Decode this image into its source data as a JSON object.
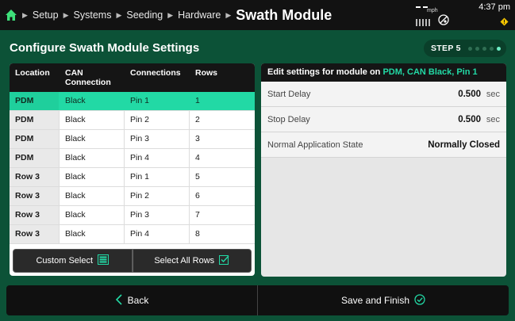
{
  "topbar": {
    "crumbs": [
      "Setup",
      "Systems",
      "Seeding",
      "Hardware"
    ],
    "title": "Swath Module",
    "speed_unit": "mph",
    "time": "4:37 pm"
  },
  "page": {
    "title": "Configure Swath Module Settings",
    "step_label": "STEP 5",
    "step_total": 5,
    "step_current": 5
  },
  "table": {
    "headers": [
      "Location",
      "CAN\nConnection",
      "Connections",
      "Rows"
    ],
    "rows": [
      {
        "location": "PDM",
        "can": "Black",
        "connection": "Pin 1",
        "rows": "1"
      },
      {
        "location": "PDM",
        "can": "Black",
        "connection": "Pin 2",
        "rows": "2"
      },
      {
        "location": "PDM",
        "can": "Black",
        "connection": "Pin 3",
        "rows": "3"
      },
      {
        "location": "PDM",
        "can": "Black",
        "connection": "Pin 4",
        "rows": "4"
      },
      {
        "location": "Row 3",
        "can": "Black",
        "connection": "Pin 1",
        "rows": "5"
      },
      {
        "location": "Row 3",
        "can": "Black",
        "connection": "Pin 2",
        "rows": "6"
      },
      {
        "location": "Row 3",
        "can": "Black",
        "connection": "Pin 3",
        "rows": "7"
      },
      {
        "location": "Row 3",
        "can": "Black",
        "connection": "Pin 4",
        "rows": "8"
      }
    ],
    "selected_index": 0,
    "custom_select_label": "Custom Select",
    "select_all_label": "Select All Rows"
  },
  "edit_panel": {
    "heading_prefix": "Edit settings for module on ",
    "heading_target": "PDM, CAN Black, Pin 1",
    "start_delay_label": "Start Delay",
    "start_delay_value": "0.500",
    "start_delay_unit": "sec",
    "stop_delay_label": "Stop Delay",
    "stop_delay_value": "0.500",
    "stop_delay_unit": "sec",
    "normal_state_label": "Normal Application State",
    "normal_state_value": "Normally Closed"
  },
  "footer": {
    "back_label": "Back",
    "finish_label": "Save and Finish"
  },
  "colors": {
    "background": "#0c5237",
    "accent": "#22d9a5",
    "home_icon": "#3ee07a",
    "warning": "#f5c400"
  }
}
